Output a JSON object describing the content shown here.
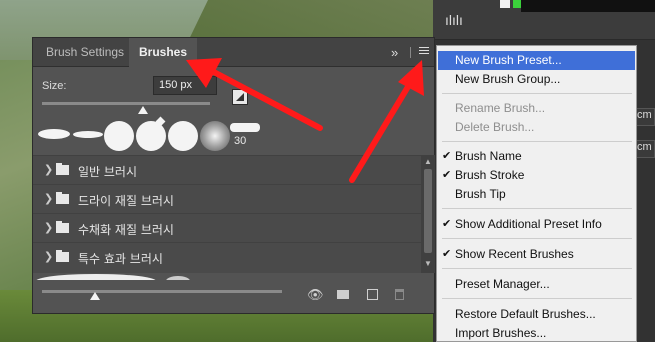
{
  "panel": {
    "tabs": [
      {
        "label": "Brush Settings",
        "active": false
      },
      {
        "label": "Brushes",
        "active": true
      }
    ],
    "chevron": "»",
    "size_label": "Size:",
    "size_value": "150 px",
    "size_level_percent": 60,
    "tip_count_label": "30",
    "groups": [
      {
        "label": "일반 브러시"
      },
      {
        "label": "드라이 재질 브러시"
      },
      {
        "label": "수채화 재질 브러시"
      },
      {
        "label": "특수 효과 브러시"
      }
    ],
    "preview_level_percent": 22
  },
  "menu": {
    "items": [
      {
        "label": "New Brush Preset...",
        "state": "highlight",
        "checked": false
      },
      {
        "label": "New Brush Group...",
        "state": "normal",
        "checked": false
      },
      {
        "label": "Rename Brush...",
        "state": "disabled",
        "checked": false
      },
      {
        "label": "Delete Brush...",
        "state": "disabled",
        "checked": false
      },
      {
        "label": "Brush Name",
        "state": "normal",
        "checked": true
      },
      {
        "label": "Brush Stroke",
        "state": "normal",
        "checked": true
      },
      {
        "label": "Brush Tip",
        "state": "normal",
        "checked": false
      },
      {
        "label": "Show Additional Preset Info",
        "state": "normal",
        "checked": true
      },
      {
        "label": "Show Recent Brushes",
        "state": "normal",
        "checked": true
      },
      {
        "label": "Preset Manager...",
        "state": "normal",
        "checked": false
      },
      {
        "label": "Restore Default Brushes...",
        "state": "normal",
        "checked": false
      },
      {
        "label": "Import Brushes...",
        "state": "normal",
        "checked": false
      }
    ]
  },
  "right_panel": {
    "field_text_1": "cm",
    "field_text_2": "cm"
  },
  "colors": {
    "accent_highlight": "#3f6fd8",
    "annotation_arrow": "#ff1a1a",
    "panel_bg": "#535353"
  }
}
